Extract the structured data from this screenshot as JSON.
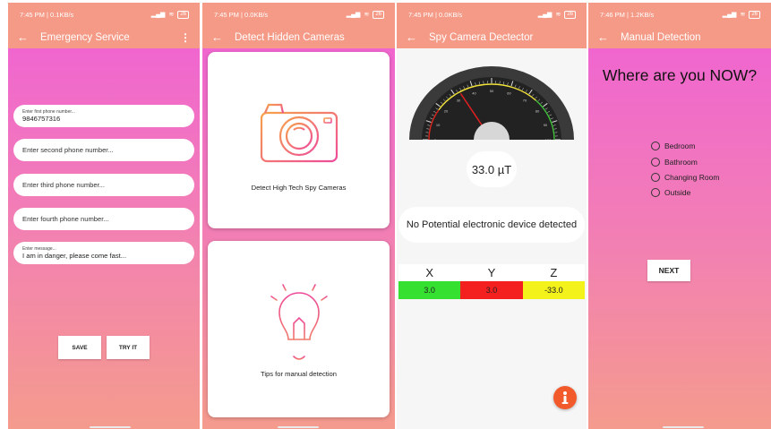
{
  "screen1": {
    "status": {
      "time": "7:45 PM | 0.1KB/s",
      "battery": "26"
    },
    "title": "Emergency Service",
    "more_icon": "⋮",
    "field1": {
      "label": "Enter first phone number...",
      "value": "9846757316"
    },
    "field2": {
      "placeholder": "Enter second phone number..."
    },
    "field3": {
      "placeholder": "Enter third phone number..."
    },
    "field4": {
      "placeholder": "Enter fourth phone number..."
    },
    "message": {
      "label": "Enter message...",
      "value": "I am in danger, please come fast..."
    },
    "save_label": "SAVE",
    "try_label": "TRY IT"
  },
  "screen2": {
    "status": {
      "time": "7:45 PM | 0.0KB/s",
      "battery": "26"
    },
    "title": "Detect Hidden Cameras",
    "card1_caption": "Detect High Tech Spy Cameras",
    "card2_caption": "Tips for manual detection"
  },
  "screen3": {
    "status": {
      "time": "7:45 PM | 0.0KB/s",
      "battery": "26"
    },
    "title": "Spy Camera Dectector",
    "reading": "33.0 µT",
    "message": "No Potential electronic device detected",
    "axes": [
      {
        "label": "X",
        "value": "3.0",
        "color": "#35e030"
      },
      {
        "label": "Y",
        "value": "3.0",
        "color": "#f41f1f"
      },
      {
        "label": "Z",
        "value": "-33.0",
        "color": "#f3f21b"
      }
    ],
    "gauge_ticks": [
      "0",
      "10",
      "20",
      "30",
      "40",
      "50",
      "60",
      "70",
      "80",
      "90",
      "100"
    ],
    "needle_value": 33
  },
  "screen4": {
    "status": {
      "time": "7:46 PM | 1.2KB/s",
      "battery": "26"
    },
    "title": "Manual Detection",
    "question": "Where are you NOW?",
    "options": [
      "Bedroom",
      "Bathroom",
      "Changing Room",
      "Outside"
    ],
    "next_label": "NEXT"
  },
  "colors": {
    "appbar": "#f59a86",
    "pink": "#f066cf",
    "fab": "#f25a2c"
  }
}
